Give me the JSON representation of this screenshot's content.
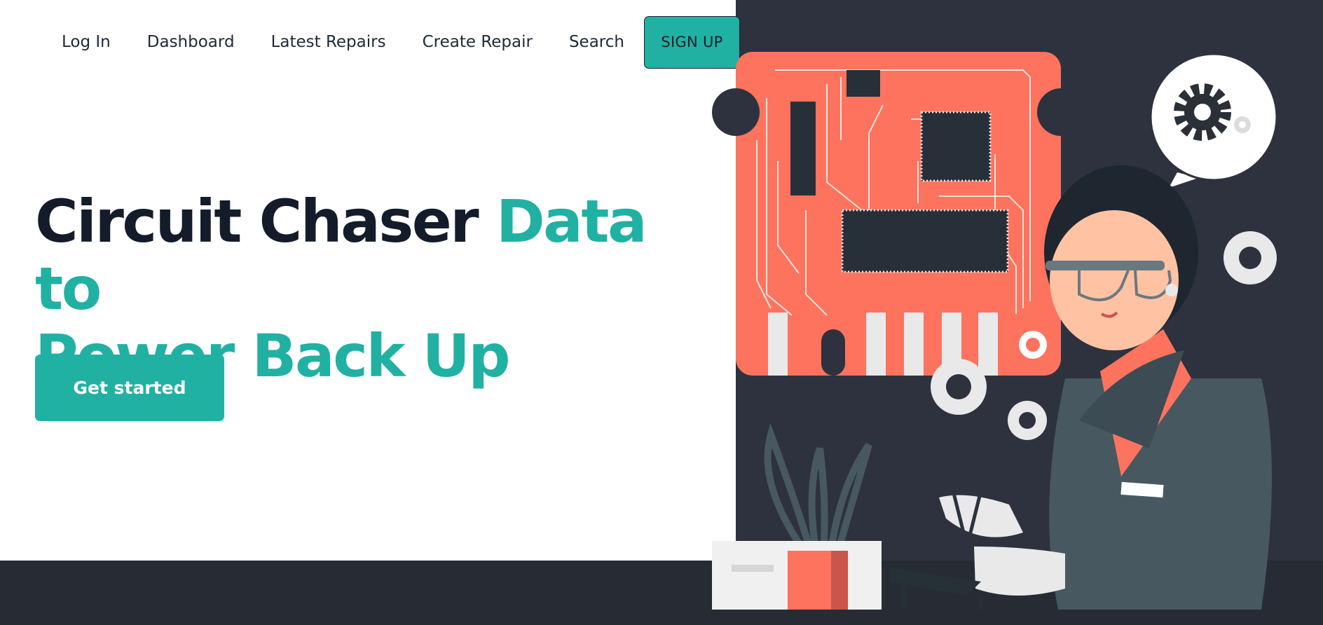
{
  "nav": {
    "links": [
      "Log In",
      "Dashboard",
      "Latest Repairs",
      "Create Repair",
      "Search"
    ],
    "signup_label": "SIGN UP"
  },
  "hero": {
    "title_dark": "Circuit Chaser",
    "title_accent_1": "Data to",
    "title_accent_2": "Power Back Up",
    "cta_label": "Get started"
  },
  "colors": {
    "accent": "#21b1a3",
    "text_dark": "#141c2b",
    "illustration_bg": "#2d323e",
    "circuit_board": "#fd735e"
  },
  "illustration": {
    "subject": "technician repairing a circuit board",
    "icons": [
      "circuit-board",
      "chip",
      "gear-icon",
      "speech-bubble",
      "plant",
      "soldering-tool"
    ]
  }
}
